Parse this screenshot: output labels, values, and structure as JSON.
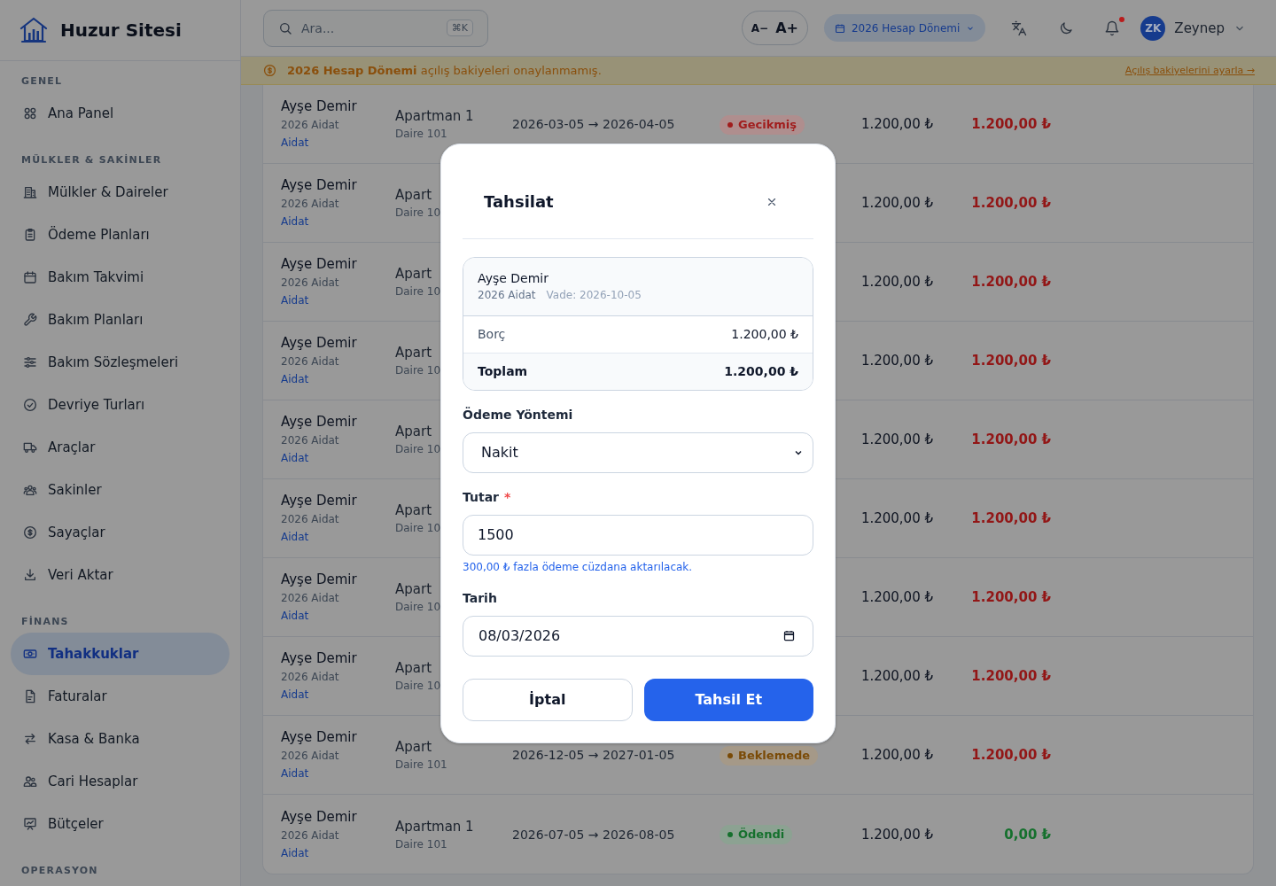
{
  "sidebar": {
    "brand": "Huzur Sitesi",
    "sections": [
      {
        "title": "GENEL",
        "items": [
          {
            "label": "Ana Panel",
            "selected": false
          }
        ]
      },
      {
        "title": "MÜLKLER & SAKİNLER",
        "items": [
          {
            "label": "Mülkler & Daireler",
            "selected": false
          },
          {
            "label": "Ödeme Planları",
            "selected": false
          },
          {
            "label": "Bakım Takvimi",
            "selected": false
          },
          {
            "label": "Bakım Planları",
            "selected": false
          },
          {
            "label": "Bakım Sözleşmeleri",
            "selected": false
          },
          {
            "label": "Devriye Turları",
            "selected": false
          },
          {
            "label": "Araçlar",
            "selected": false
          },
          {
            "label": "Sakinler",
            "selected": false
          },
          {
            "label": "Sayaçlar",
            "selected": false
          },
          {
            "label": "Veri Aktar",
            "selected": false
          }
        ]
      },
      {
        "title": "FİNANS",
        "items": [
          {
            "label": "Tahakkuklar",
            "selected": true
          },
          {
            "label": "Faturalar",
            "selected": false
          },
          {
            "label": "Kasa & Banka",
            "selected": false
          },
          {
            "label": "Cari Hesaplar",
            "selected": false
          },
          {
            "label": "Bütçeler",
            "selected": false
          }
        ]
      },
      {
        "title": "OPERASYON"
      }
    ]
  },
  "topbar": {
    "search": {
      "placeholder": "Ara...",
      "shortcut": "⌘K"
    },
    "font_size": {
      "decrease": "A−",
      "increase": "A+"
    },
    "period": "2026 Hesap Dönemi",
    "notifications": {
      "unread": true
    },
    "user": {
      "initials": "ZK",
      "name": "Zeynep"
    }
  },
  "banner": {
    "message": "**2026 Hesap Dönemi** açılış bakiyeleri onaylanmamış.",
    "link": "Açılış bakiyelerini ayarla →"
  },
  "table": {
    "rows": [
      {
        "name": "Ayşe Demir",
        "charge": "2026 Aidat",
        "type": "Aidat",
        "building": "Apartman 1",
        "unit": "Daire 101",
        "period": "2026-03-05 → 2026-04-05",
        "status": {
          "label": "Gecikmiş",
          "color": "#a11d1d"
        },
        "amount": "1.200,00 ₺",
        "remaining": {
          "value": "1.200,00 ₺",
          "color": "#921616"
        }
      },
      {
        "name": "Ayşe Demir",
        "charge": "2026 Aidat",
        "type": "Aidat",
        "building": "Apart",
        "unit": "Daire 10",
        "amount": "1.200,00 ₺",
        "remaining": {
          "value": "1.200,00 ₺",
          "color": "#921616"
        }
      },
      {
        "name": "Ayşe Demir",
        "charge": "2026 Aidat",
        "type": "Aidat",
        "building": "Apart",
        "unit": "Daire 10",
        "amount": "1.200,00 ₺",
        "remaining": {
          "value": "1.200,00 ₺",
          "color": "#921616"
        }
      },
      {
        "name": "Ayşe Demir",
        "charge": "2026 Aidat",
        "type": "Aidat",
        "building": "Apart",
        "unit": "Daire 10",
        "amount": "1.200,00 ₺",
        "remaining": {
          "value": "1.200,00 ₺",
          "color": "#921616"
        }
      },
      {
        "name": "Ayşe Demir",
        "charge": "2026 Aidat",
        "type": "Aidat",
        "building": "Apart",
        "unit": "Daire 10",
        "amount": "1.200,00 ₺",
        "remaining": {
          "value": "1.200,00 ₺",
          "color": "#921616"
        }
      },
      {
        "name": "Ayşe Demir",
        "charge": "2026 Aidat",
        "type": "Aidat",
        "building": "Apart",
        "unit": "Daire 10",
        "amount": "1.200,00 ₺",
        "remaining": {
          "value": "1.200,00 ₺",
          "color": "#921616"
        }
      },
      {
        "name": "Ayşe Demir",
        "charge": "2026 Aidat",
        "type": "Aidat",
        "building": "Apart",
        "unit": "Daire 10",
        "amount": "1.200,00 ₺",
        "remaining": {
          "value": "1.200,00 ₺",
          "color": "#921616"
        }
      },
      {
        "name": "Ayşe Demir",
        "charge": "2026 Aidat",
        "type": "Aidat",
        "building": "Apart",
        "unit": "Daire 10",
        "amount": "1.200,00 ₺",
        "remaining": {
          "value": "1.200,00 ₺",
          "color": "#921616"
        }
      },
      {
        "name": "Ayşe Demir",
        "charge": "2026 Aidat",
        "type": "Aidat",
        "building": "Apart",
        "unit": "Daire 101",
        "period": "2026-12-05 → 2027-01-05",
        "status": {
          "label": "Beklemede",
          "color": "#7a4a06"
        },
        "amount": "1.200,00 ₺",
        "remaining": {
          "value": "1.200,00 ₺",
          "color": "#921616"
        }
      },
      {
        "name": "Ayşe Demir",
        "charge": "2026 Aidat",
        "type": "Aidat",
        "building": "Apartman 1",
        "unit": "Daire 101",
        "period": "2026-07-05 → 2026-08-05",
        "status": {
          "label": "Ödendi",
          "color": "#15702d"
        },
        "amount": "1.200,00 ₺",
        "remaining": {
          "value": "0,00 ₺",
          "color": "#15702d"
        }
      }
    ]
  },
  "modal": {
    "title": "Tahsilat",
    "summary": {
      "name": "Ayşe Demir",
      "charge": "2026 Aidat",
      "due": "Vade: 2026-10-05",
      "lines": [
        {
          "label": "Borç",
          "value": "1.200,00 ₺",
          "kind": "item"
        },
        {
          "label": "Toplam",
          "value": "1.200,00 ₺",
          "kind": "total"
        }
      ]
    },
    "fields": [
      {
        "label": "Ödeme Yöntemi",
        "kind": "select",
        "value": "Nakit"
      },
      {
        "label": "Tutar",
        "required_mark": "*",
        "kind": "text",
        "value": "1500",
        "hint": "300,00 ₺ fazla ödeme cüzdana aktarılacak."
      },
      {
        "label": "Tarih",
        "kind": "date",
        "value": "08/03/2026"
      }
    ],
    "buttons": [
      {
        "label": "İptal",
        "kind": "secondary"
      },
      {
        "label": "Tahsil Et",
        "kind": "primary"
      }
    ]
  }
}
